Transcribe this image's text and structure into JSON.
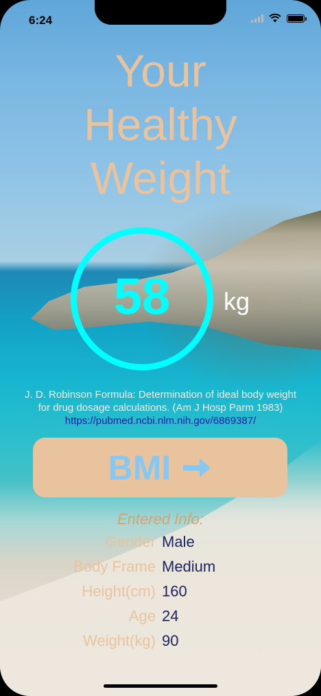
{
  "status_bar": {
    "time": "6:24"
  },
  "title": {
    "lines": [
      "Your",
      "Healthy",
      "Weight"
    ]
  },
  "result": {
    "value": "58",
    "unit": "kg"
  },
  "formula": {
    "line1": "J. D. Robinson Formula: Determination of ideal body weight",
    "line2": "for drug dosage calculations. (Am J Hosp Parm 1983)",
    "link": "https://pubmed.ncbi.nlm.nih.gov/6869387/"
  },
  "bmi_button": {
    "label": "BMI",
    "icon": "arrow-right-icon"
  },
  "entered_info": {
    "heading": "Entered Info:",
    "rows": [
      {
        "label": "Gender",
        "value": "Male"
      },
      {
        "label": "Body Frame",
        "value": "Medium"
      },
      {
        "label": "Height(cm)",
        "value": "160"
      },
      {
        "label": "Age",
        "value": "24"
      },
      {
        "label": "Weight(kg)",
        "value": "90"
      }
    ]
  },
  "colors": {
    "accent_ring": "#00ffff",
    "title": "#e8c39e",
    "button_bg": "#e8c39e",
    "button_text": "#86c8f1",
    "value_text": "#1d2461"
  }
}
